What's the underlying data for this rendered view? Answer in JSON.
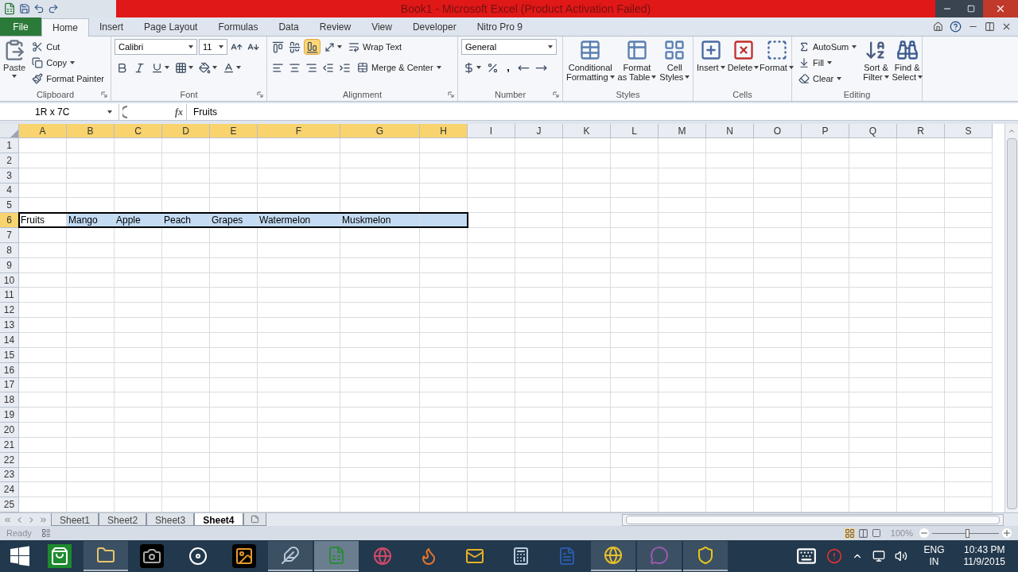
{
  "window": {
    "title": "Book1 - Microsoft Excel (Product Activation Failed)"
  },
  "tabs": [
    {
      "label": "File",
      "kind": "file",
      "selected": false
    },
    {
      "label": "Home",
      "kind": "tab",
      "selected": true
    },
    {
      "label": "Insert",
      "kind": "tab",
      "selected": false
    },
    {
      "label": "Page Layout",
      "kind": "tab",
      "selected": false
    },
    {
      "label": "Formulas",
      "kind": "tab",
      "selected": false
    },
    {
      "label": "Data",
      "kind": "tab",
      "selected": false
    },
    {
      "label": "Review",
      "kind": "tab",
      "selected": false
    },
    {
      "label": "View",
      "kind": "tab",
      "selected": false
    },
    {
      "label": "Developer",
      "kind": "tab",
      "selected": false
    },
    {
      "label": "Nitro Pro 9",
      "kind": "tab",
      "selected": false
    }
  ],
  "ribbon": {
    "clipboard": {
      "label": "Clipboard",
      "paste": "Paste",
      "cut": "Cut",
      "copy": "Copy",
      "format_painter": "Format Painter"
    },
    "font": {
      "label": "Font",
      "font_name": "Calibri",
      "font_size": "11"
    },
    "alignment": {
      "label": "Alignment",
      "bottom_align_selected": true,
      "wrap_text": "Wrap Text",
      "merge_center": "Merge & Center"
    },
    "number": {
      "label": "Number",
      "format": "General",
      "comma": ","
    },
    "styles": {
      "label": "Styles",
      "buttons": [
        {
          "lines": [
            "Conditional",
            "Formatting"
          ]
        },
        {
          "lines": [
            "Format",
            "as Table"
          ]
        },
        {
          "lines": [
            "Cell",
            "Styles"
          ]
        }
      ]
    },
    "cells": {
      "label": "Cells",
      "buttons": [
        "Insert",
        "Delete",
        "Format"
      ]
    },
    "editing": {
      "label": "Editing",
      "autosum": "AutoSum",
      "fill": "Fill",
      "clear": "Clear",
      "sort_filter": [
        "Sort &",
        "Filter"
      ],
      "find_select": [
        "Find &",
        "Select"
      ]
    }
  },
  "formula_bar": {
    "name_box": "1R x 7C",
    "function_label": "fx",
    "value": "Fruits"
  },
  "grid": {
    "columns": [
      {
        "label": "A",
        "selected": true
      },
      {
        "label": "B",
        "selected": true
      },
      {
        "label": "C",
        "selected": true
      },
      {
        "label": "D",
        "selected": true
      },
      {
        "label": "E",
        "selected": true
      },
      {
        "label": "F",
        "selected": true
      },
      {
        "label": "G",
        "selected": true
      },
      {
        "label": "H",
        "selected": true
      },
      {
        "label": "I",
        "selected": false
      },
      {
        "label": "J",
        "selected": false
      },
      {
        "label": "K",
        "selected": false
      },
      {
        "label": "L",
        "selected": false
      },
      {
        "label": "M",
        "selected": false
      },
      {
        "label": "N",
        "selected": false
      },
      {
        "label": "O",
        "selected": false
      },
      {
        "label": "P",
        "selected": false
      },
      {
        "label": "Q",
        "selected": false
      },
      {
        "label": "R",
        "selected": false
      },
      {
        "label": "S",
        "selected": false
      }
    ],
    "rows": [
      {
        "label": "1",
        "selected": false
      },
      {
        "label": "2",
        "selected": false
      },
      {
        "label": "3",
        "selected": false
      },
      {
        "label": "4",
        "selected": false
      },
      {
        "label": "5",
        "selected": false
      },
      {
        "label": "6",
        "selected": true,
        "cells": [
          {
            "text": "Fruits",
            "selected": true,
            "active": true
          },
          {
            "text": "Mango",
            "selected": true,
            "active": false
          },
          {
            "text": "Apple",
            "selected": true,
            "active": false
          },
          {
            "text": "Peach",
            "selected": true,
            "active": false
          },
          {
            "text": "Grapes",
            "selected": true,
            "active": false
          },
          {
            "text": "Watermelon",
            "selected": true,
            "active": false
          },
          {
            "text": "Muskmelon",
            "selected": true,
            "active": false
          },
          {
            "selected": true,
            "active": false
          }
        ]
      },
      {
        "label": "7",
        "selected": false
      },
      {
        "label": "8",
        "selected": false
      },
      {
        "label": "9",
        "selected": false
      },
      {
        "label": "10",
        "selected": false
      },
      {
        "label": "11",
        "selected": false
      },
      {
        "label": "12",
        "selected": false
      },
      {
        "label": "13",
        "selected": false
      },
      {
        "label": "14",
        "selected": false
      },
      {
        "label": "15",
        "selected": false
      },
      {
        "label": "16",
        "selected": false
      },
      {
        "label": "17",
        "selected": false
      },
      {
        "label": "18",
        "selected": false
      },
      {
        "label": "19",
        "selected": false
      },
      {
        "label": "20",
        "selected": false
      },
      {
        "label": "21",
        "selected": false
      },
      {
        "label": "22",
        "selected": false
      },
      {
        "label": "23",
        "selected": false
      },
      {
        "label": "24",
        "selected": false
      },
      {
        "label": "25",
        "selected": false
      }
    ]
  },
  "sheet_tabs": [
    {
      "label": "Sheet1",
      "selected": false
    },
    {
      "label": "Sheet2",
      "selected": false
    },
    {
      "label": "Sheet3",
      "selected": false
    },
    {
      "label": "Sheet4",
      "selected": true
    }
  ],
  "status_bar": {
    "status": "Ready",
    "zoom": "100%",
    "zoom_slider": {
      "level": 0.52
    }
  },
  "taskbar": {
    "items": [
      {
        "kind": "store",
        "running": false,
        "selected": false
      },
      {
        "kind": "folder",
        "running": true,
        "selected": false
      },
      {
        "kind": "camera",
        "running": false,
        "selected": false
      },
      {
        "kind": "hp",
        "running": false,
        "selected": false
      },
      {
        "kind": "photos",
        "running": false,
        "selected": false
      },
      {
        "kind": "feather",
        "running": true,
        "selected": false
      },
      {
        "kind": "excel",
        "running": true,
        "selected": true
      },
      {
        "kind": "media",
        "running": false,
        "selected": false
      },
      {
        "kind": "firefox",
        "running": false,
        "selected": false
      },
      {
        "kind": "mail",
        "running": false,
        "selected": false
      },
      {
        "kind": "calculator",
        "running": false,
        "selected": false
      },
      {
        "kind": "word",
        "running": false,
        "selected": false
      },
      {
        "kind": "chrome",
        "running": true,
        "selected": false
      },
      {
        "kind": "chat",
        "running": true,
        "selected": false
      },
      {
        "kind": "norton",
        "running": true,
        "selected": false
      }
    ],
    "language": "ENG",
    "region": "IN",
    "time": "10:43 PM",
    "date": "11/9/2015"
  }
}
